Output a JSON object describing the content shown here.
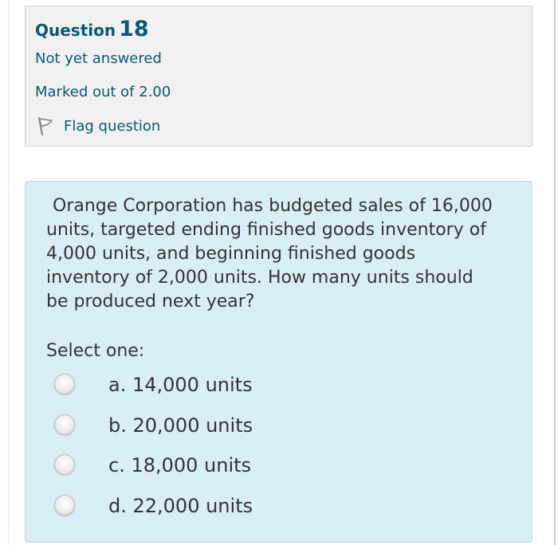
{
  "question_info": {
    "title_word": "Question",
    "number": "18",
    "state": "Not yet answered",
    "grade": "Marked out of 2.00",
    "flag_label": "Flag question",
    "flag_icon": "flag-icon"
  },
  "question": {
    "text": "Orange Corporation has budgeted sales of 16,000 units, targeted ending finished goods inventory of 4,000 units, and beginning finished goods inventory of 2,000 units. How many units should be produced next year?",
    "prompt": "Select one:",
    "options": [
      {
        "label": "a. 14,000 units"
      },
      {
        "label": "b. 20,000 units"
      },
      {
        "label": "c. 18,000 units"
      },
      {
        "label": "d. 22,000 units"
      }
    ]
  },
  "colors": {
    "info_background": "#f0f0f0",
    "formulation_background": "#d9edf7",
    "link_color": "#0b5a72"
  }
}
